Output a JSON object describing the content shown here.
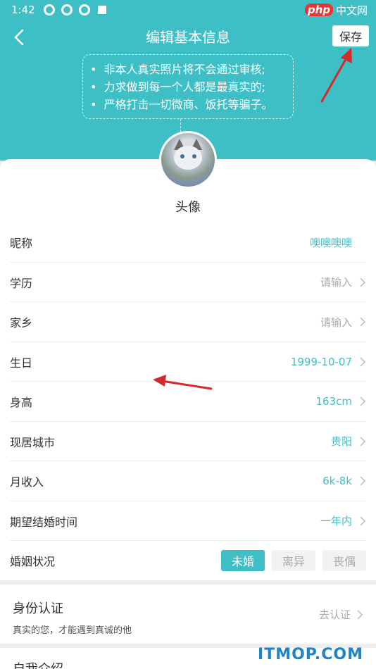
{
  "status_bar": {
    "time": "1:42",
    "watermark_php": "php",
    "watermark_site": "中文网"
  },
  "header": {
    "title": "编辑基本信息",
    "save_label": "保存",
    "notice": [
      "非本人真实照片将不会通过审核;",
      "力求做到每一个人都是最真实的;",
      "严格打击一切微商、饭托等骗子。"
    ]
  },
  "avatar": {
    "label": "头像"
  },
  "profile": {
    "rows": [
      {
        "label": "昵称",
        "value": "噢噢噢噢",
        "placeholder": false,
        "chevron": false
      },
      {
        "label": "学历",
        "value": "请输入",
        "placeholder": true,
        "chevron": true
      },
      {
        "label": "家乡",
        "value": "请输入",
        "placeholder": true,
        "chevron": true
      },
      {
        "label": "生日",
        "value": "1999-10-07",
        "placeholder": false,
        "chevron": true
      },
      {
        "label": "身高",
        "value": "163cm",
        "placeholder": false,
        "chevron": true
      },
      {
        "label": "现居城市",
        "value": "贵阳",
        "placeholder": false,
        "chevron": true
      },
      {
        "label": "月收入",
        "value": "6k-8k",
        "placeholder": false,
        "chevron": true
      },
      {
        "label": "期望结婚时间",
        "value": "一年内",
        "placeholder": false,
        "chevron": true
      }
    ],
    "marital": {
      "label": "婚姻状况",
      "options": [
        "未婚",
        "离异",
        "丧偶"
      ],
      "selected": "未婚"
    }
  },
  "verification": {
    "title": "身份认证",
    "subtitle": "真实的您，才能遇到真诚的他",
    "action": "去认证"
  },
  "intro": {
    "title": "自我介绍"
  },
  "watermark": "ITMOP.COM",
  "colors": {
    "accent": "#3ebfc6",
    "arrow": "#d62a2a"
  }
}
